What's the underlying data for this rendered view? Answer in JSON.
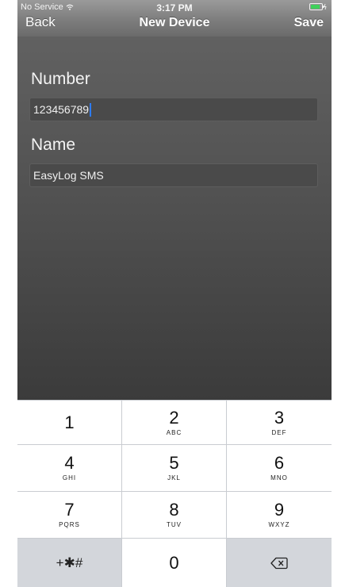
{
  "status": {
    "carrier": "No Service",
    "time": "3:17 PM"
  },
  "nav": {
    "back": "Back",
    "title": "New Device",
    "save": "Save"
  },
  "form": {
    "number_label": "Number",
    "number_value": "123456789",
    "name_label": "Name",
    "name_value": "EasyLog SMS"
  },
  "keypad": {
    "keys": [
      {
        "digit": "1",
        "letters": ""
      },
      {
        "digit": "2",
        "letters": "ABC"
      },
      {
        "digit": "3",
        "letters": "DEF"
      },
      {
        "digit": "4",
        "letters": "GHI"
      },
      {
        "digit": "5",
        "letters": "JKL"
      },
      {
        "digit": "6",
        "letters": "MNO"
      },
      {
        "digit": "7",
        "letters": "PQRS"
      },
      {
        "digit": "8",
        "letters": "TUV"
      },
      {
        "digit": "9",
        "letters": "WXYZ"
      },
      {
        "digit": "0",
        "letters": ""
      }
    ],
    "symbols": "+✱#",
    "delete_icon": "delete-backspace-icon"
  },
  "icons": [
    "wifi-icon",
    "battery-icon",
    "delete-backspace-icon"
  ],
  "colors": {
    "caret": "#2d7bff",
    "battery": "#3fd15a"
  }
}
